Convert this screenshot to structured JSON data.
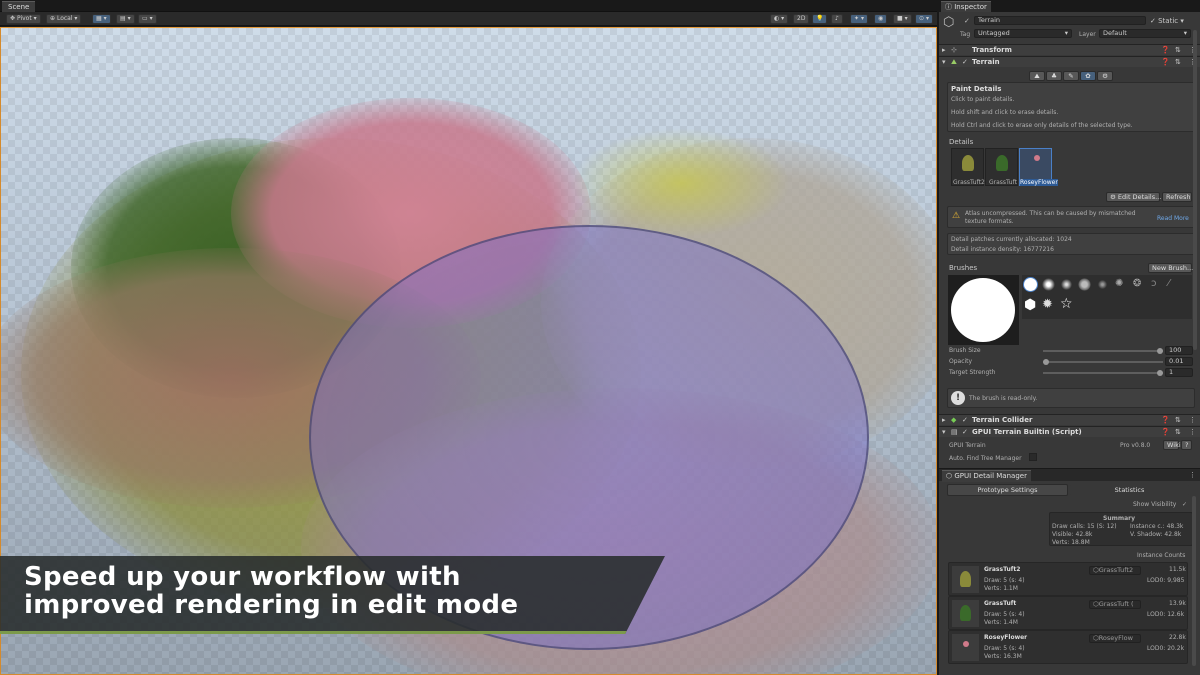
{
  "scene": {
    "tab": "Scene",
    "pivot": "Pivot",
    "local": "Local",
    "mode2d": "2D"
  },
  "caption": {
    "line1": "Speed up your workflow with",
    "line2": "improved rendering in edit mode"
  },
  "inspector": {
    "tab": "Inspector",
    "object_name": "Terrain",
    "static_label": "Static",
    "tag_label": "Tag",
    "tag_value": "Untagged",
    "layer_label": "Layer",
    "layer_value": "Default",
    "components": {
      "transform": "Transform",
      "terrain": "Terrain",
      "collider": "Terrain Collider",
      "gpui": "GPUI Terrain Builtin (Script)"
    },
    "paint": {
      "title": "Paint Details",
      "l1": "Click to paint details.",
      "l2": "Hold shift and click to erase details.",
      "l3": "Hold Ctrl and click to erase only details of the selected type."
    },
    "details_label": "Details",
    "details": [
      "GrassTuft2",
      "GrassTuft",
      "RoseyFlower"
    ],
    "edit_details": "Edit Details...",
    "refresh": "Refresh",
    "warning": "Atlas uncompressed. This can be caused by mismatched texture formats.",
    "read_more": "Read More",
    "patches": "Detail patches currently allocated: 1024",
    "density": "Detail instance density: 16777216",
    "brushes_label": "Brushes",
    "new_brush": "New Brush...",
    "brush_size_label": "Brush Size",
    "brush_size": "100",
    "opacity_label": "Opacity",
    "opacity": "0.01",
    "target_label": "Target Strength",
    "target": "1",
    "readonly": "The brush is read-only.",
    "gpui_terrain": "GPUI Terrain",
    "version": "Pro v0.8.0",
    "wiki": "Wiki",
    "help": "?",
    "find_tree": "Auto. Find Tree Manager"
  },
  "detail_manager": {
    "tab": "GPUI Detail Manager",
    "tabs": [
      "Prototype Settings",
      "Statistics"
    ],
    "show_visibility": "Show Visibility",
    "check": "✓",
    "summary_title": "Summary",
    "draw_calls": "Draw calls: 15 (S: 12)",
    "instance": "Instance c.: 48.3k",
    "visible": "Visible: 42.8k",
    "vshadow": "V. Shadow: 42.8k",
    "verts": "Verts: 18.8M",
    "instance_counts": "Instance Counts",
    "items": [
      {
        "name": "GrassTuft2",
        "ref": "GrassTuft2",
        "draw": "Draw: 5 (s: 4)",
        "verts": "Verts: 1.1M",
        "count": "11.5k",
        "lod": "LOD0: 9,985"
      },
      {
        "name": "GrassTuft",
        "ref": "GrassTuft (",
        "draw": "Draw: 5 (s: 4)",
        "verts": "Verts: 1.4M",
        "count": "13.9k",
        "lod": "LOD0: 12.6k"
      },
      {
        "name": "RoseyFlower",
        "ref": "RoseyFlow",
        "draw": "Draw: 5 (s: 4)",
        "verts": "Verts: 16.3M",
        "count": "22.8k",
        "lod": "LOD0: 20.2k"
      }
    ]
  }
}
